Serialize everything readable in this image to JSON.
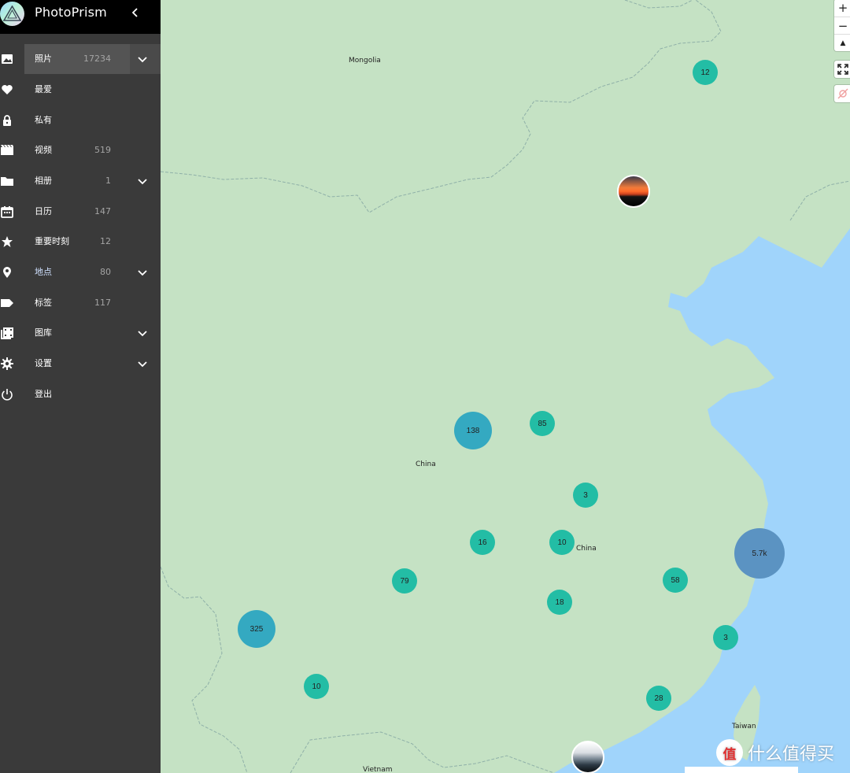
{
  "app": {
    "title": "PhotoPrism"
  },
  "sidebar": {
    "items": [
      {
        "label": "照片",
        "count": "17234",
        "icon": "image-icon",
        "expand": true,
        "active": true
      },
      {
        "label": "最爱",
        "count": "",
        "icon": "heart-icon",
        "expand": false
      },
      {
        "label": "私有",
        "count": "",
        "icon": "lock-icon",
        "expand": false
      },
      {
        "label": "视频",
        "count": "519",
        "icon": "video-icon",
        "expand": false
      },
      {
        "label": "相册",
        "count": "1",
        "icon": "folder-icon",
        "expand": true
      },
      {
        "label": "日历",
        "count": "147",
        "icon": "calendar-icon",
        "expand": false
      },
      {
        "label": "重要时刻",
        "count": "12",
        "icon": "star-icon",
        "expand": false
      },
      {
        "label": "地点",
        "count": "80",
        "icon": "place-icon",
        "expand": true,
        "highlight": true
      },
      {
        "label": "标签",
        "count": "117",
        "icon": "label-icon",
        "expand": false
      },
      {
        "label": "图库",
        "count": "",
        "icon": "library-icon",
        "expand": true
      },
      {
        "label": "设置",
        "count": "",
        "icon": "gear-icon",
        "expand": true
      },
      {
        "label": "登出",
        "count": "",
        "icon": "power-icon",
        "expand": false
      }
    ]
  },
  "map": {
    "labels": [
      "Mongolia",
      "China",
      "China",
      "Taiwan",
      "Vietnam"
    ],
    "clusters": [
      "12",
      "138",
      "85",
      "3",
      "16",
      "10",
      "79",
      "18",
      "58",
      "5.7k",
      "325",
      "3",
      "10",
      "28"
    ],
    "controls": {
      "zoom_in": "+",
      "zoom_out": "−",
      "compass": "▲"
    }
  },
  "watermark": {
    "text": "什么值得买",
    "icon_text": "值"
  },
  "colors": {
    "land": "#c5e2c4",
    "water": "#a0d4fb",
    "sidebar": "#3a3a3a",
    "cluster": "#23bda5"
  }
}
